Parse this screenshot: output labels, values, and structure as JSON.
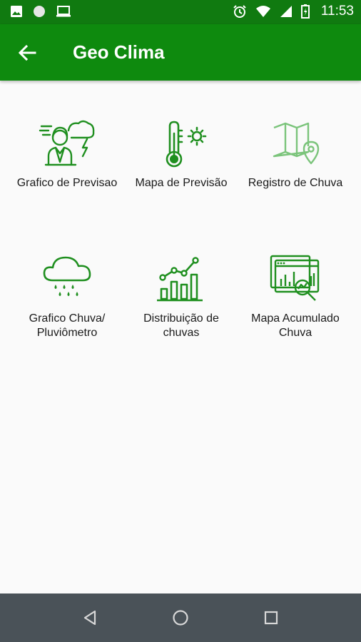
{
  "status_bar": {
    "time": "11:53",
    "icons": [
      "image-icon",
      "circle-icon",
      "laptop-icon",
      "alarm-icon",
      "wifi-icon",
      "signal-icon",
      "battery-icon"
    ]
  },
  "app_bar": {
    "title": "Geo Clima",
    "back_icon": "back-arrow-icon"
  },
  "menu": {
    "items": [
      {
        "label": "Grafico de Previsao",
        "icon": "weather-forecast-person-icon"
      },
      {
        "label": "Mapa de Previsão",
        "icon": "thermometer-sun-icon"
      },
      {
        "label": "Registro de Chuva",
        "icon": "map-location-icon"
      },
      {
        "label": "Grafico Chuva/\nPluviômetro",
        "icon": "rain-cloud-icon"
      },
      {
        "label": "Distribuição de\nchuvas",
        "icon": "bar-chart-trend-icon"
      },
      {
        "label": "Mapa Acumulado\nChuva",
        "icon": "analytics-magnifier-icon"
      }
    ]
  },
  "colors": {
    "status_bar": "#107a10",
    "app_bar": "#0e8a0e",
    "icon_green": "#1f8f1f",
    "background": "#fafafa",
    "nav_bar": "#4a5258"
  },
  "nav_bar": {
    "icons": [
      "nav-back-icon",
      "nav-home-icon",
      "nav-recents-icon"
    ]
  }
}
